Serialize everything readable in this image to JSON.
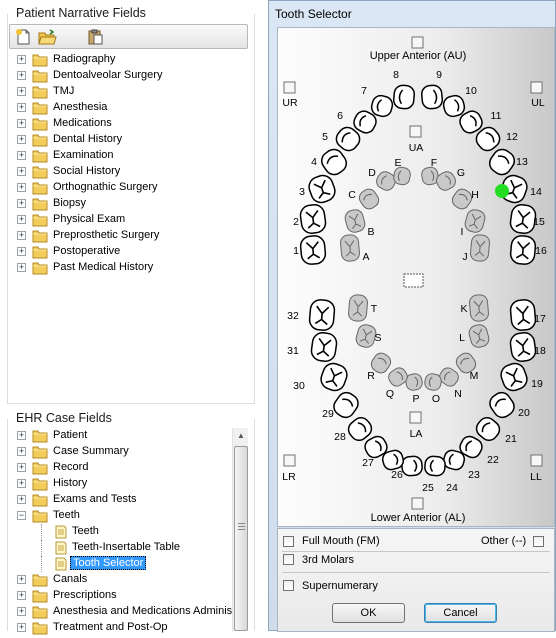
{
  "left_panel": {
    "narrative_title": "Patient Narrative Fields",
    "narrative_items": [
      "Radiography",
      "Dentoalveolar Surgery",
      "TMJ",
      "Anesthesia",
      "Medications",
      "Dental History",
      "Examination",
      "Social History",
      "Orthognathic Surgery",
      "Biopsy",
      "Physical Exam",
      "Preprosthetic Surgery",
      "Postoperative",
      "Past Medical History"
    ],
    "ehr_title": "EHR Case Fields",
    "ehr_items_top": [
      "Patient",
      "Case Summary",
      "Record",
      "History",
      "Exams and Tests",
      "Teeth"
    ],
    "teeth_children": [
      "Teeth",
      "Teeth-Insertable Table",
      "Tooth Selector"
    ],
    "ehr_items_bottom": [
      "Canals",
      "Prescriptions",
      "Anesthesia and Medications Administ",
      "Treatment and Post-Op"
    ],
    "selected_item": "Tooth Selector"
  },
  "dialog": {
    "title": "Tooth Selector",
    "upper_anterior_label": "Upper Anterior (AU)",
    "lower_anterior_label": "Lower Anterior (AL)",
    "quadrants": {
      "ur": "UR",
      "ul": "UL",
      "lr": "LR",
      "ll": "LL",
      "ua": "UA",
      "la": "LA"
    },
    "upper_permanent": [
      "1",
      "2",
      "3",
      "4",
      "5",
      "6",
      "7",
      "8",
      "9",
      "10",
      "11",
      "12",
      "13",
      "14",
      "15",
      "16"
    ],
    "lower_permanent": [
      "17",
      "18",
      "19",
      "20",
      "21",
      "22",
      "23",
      "24",
      "25",
      "26",
      "27",
      "28",
      "29",
      "30",
      "31",
      "32"
    ],
    "upper_primary": [
      "A",
      "B",
      "C",
      "D",
      "E",
      "F",
      "G",
      "H",
      "I",
      "J"
    ],
    "lower_primary": [
      "K",
      "L",
      "M",
      "N",
      "O",
      "P",
      "Q",
      "R",
      "S",
      "T"
    ],
    "selected_tooth": "14",
    "marker_color": "#22dd22",
    "options": {
      "full_mouth": "Full Mouth (FM)",
      "other": "Other (--)",
      "third_molars": "3rd Molars",
      "supernumerary": "Supernumerary"
    },
    "ok_label": "OK",
    "cancel_label": "Cancel"
  }
}
